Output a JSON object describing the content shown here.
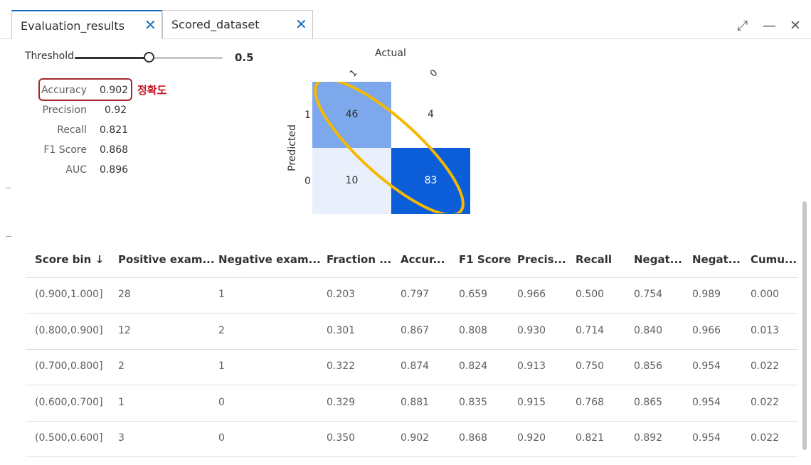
{
  "tabs": [
    {
      "label": "Evaluation_results",
      "active": true
    },
    {
      "label": "Scored_dataset",
      "active": false
    }
  ],
  "window_controls": {
    "expand": "⤢",
    "minimize": "—",
    "close": "✕"
  },
  "threshold": {
    "label": "Threshold",
    "value": 0.5,
    "value_text": "0.5"
  },
  "metrics": [
    {
      "label": "Accuracy",
      "value": "0.902"
    },
    {
      "label": "Precision",
      "value": "0.92"
    },
    {
      "label": "Recall",
      "value": "0.821"
    },
    {
      "label": "F1 Score",
      "value": "0.868"
    },
    {
      "label": "AUC",
      "value": "0.896"
    }
  ],
  "annotation": {
    "text": "정확도",
    "color": "#c50f1f"
  },
  "chart_data": {
    "type": "heatmap",
    "title": "Actual",
    "xlabel": "Actual",
    "ylabel": "Predicted",
    "x_categories": [
      "1",
      "0"
    ],
    "y_categories": [
      "1",
      "0"
    ],
    "values": [
      [
        46,
        4
      ],
      [
        10,
        83
      ]
    ],
    "colors": [
      [
        "#7da9ec",
        "#ffffff"
      ],
      [
        "#e9f0fc",
        "#0b5ed7"
      ]
    ],
    "annotation_ellipse_color": "#f6b800"
  },
  "table": {
    "columns": [
      "Score bin ↓",
      "Positive exam...",
      "Negative exam...",
      "Fraction ...",
      "Accur...",
      "F1 Score",
      "Precis...",
      "Recall",
      "Negat...",
      "Negat...",
      "Cumu..."
    ],
    "rows": [
      [
        "(0.900,1.000]",
        "28",
        "1",
        "0.203",
        "0.797",
        "0.659",
        "0.966",
        "0.500",
        "0.754",
        "0.989",
        "0.000"
      ],
      [
        "(0.800,0.900]",
        "12",
        "2",
        "0.301",
        "0.867",
        "0.808",
        "0.930",
        "0.714",
        "0.840",
        "0.966",
        "0.013"
      ],
      [
        "(0.700,0.800]",
        "2",
        "1",
        "0.322",
        "0.874",
        "0.824",
        "0.913",
        "0.750",
        "0.856",
        "0.954",
        "0.022"
      ],
      [
        "(0.600,0.700]",
        "1",
        "0",
        "0.329",
        "0.881",
        "0.835",
        "0.915",
        "0.768",
        "0.865",
        "0.954",
        "0.022"
      ],
      [
        "(0.500,0.600]",
        "3",
        "0",
        "0.350",
        "0.902",
        "0.868",
        "0.920",
        "0.821",
        "0.892",
        "0.954",
        "0.022"
      ]
    ]
  }
}
